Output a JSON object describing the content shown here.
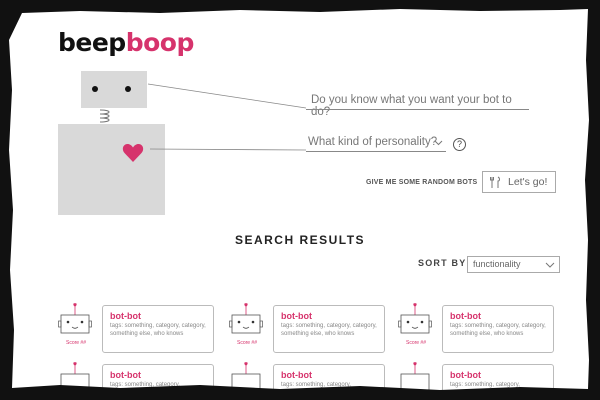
{
  "header": {
    "logo_part1": "beep",
    "logo_part2": "boop"
  },
  "form": {
    "goal_placeholder": "Do you know what you want your bot to do?",
    "personality_placeholder": "What kind of personality?",
    "help_symbol": "?",
    "random_label": "GIVE ME SOME RANDOM BOTS",
    "go_label": "Let's go!"
  },
  "results": {
    "title": "SEARCH RESULTS",
    "sort_label": "SORT BY",
    "sort_value": "functionality",
    "cards": [
      {
        "name": "bot-bot",
        "tags": "tags: something, category, category, something else, who knows",
        "score": "Score ##"
      },
      {
        "name": "bot-bot",
        "tags": "tags: something, category, category, something else, who knows",
        "score": "Score ##"
      },
      {
        "name": "bot-bot",
        "tags": "tags: something, category, category, something else, who knows",
        "score": "Score ##"
      },
      {
        "name": "bot-bot",
        "tags": "tags: something, category,",
        "score": ""
      },
      {
        "name": "bot-bot",
        "tags": "tags: something, category,",
        "score": ""
      },
      {
        "name": "bot-bot",
        "tags": "tags: something, category,",
        "score": ""
      }
    ]
  },
  "colors": {
    "accent": "#d6336c",
    "robot_gray": "#d9d9d9",
    "border_gray": "#bbbbbb"
  },
  "icons": {
    "heart": "heart-icon",
    "tool": "tools-icon",
    "chevron": "chevron-down-icon",
    "help": "help-icon"
  }
}
